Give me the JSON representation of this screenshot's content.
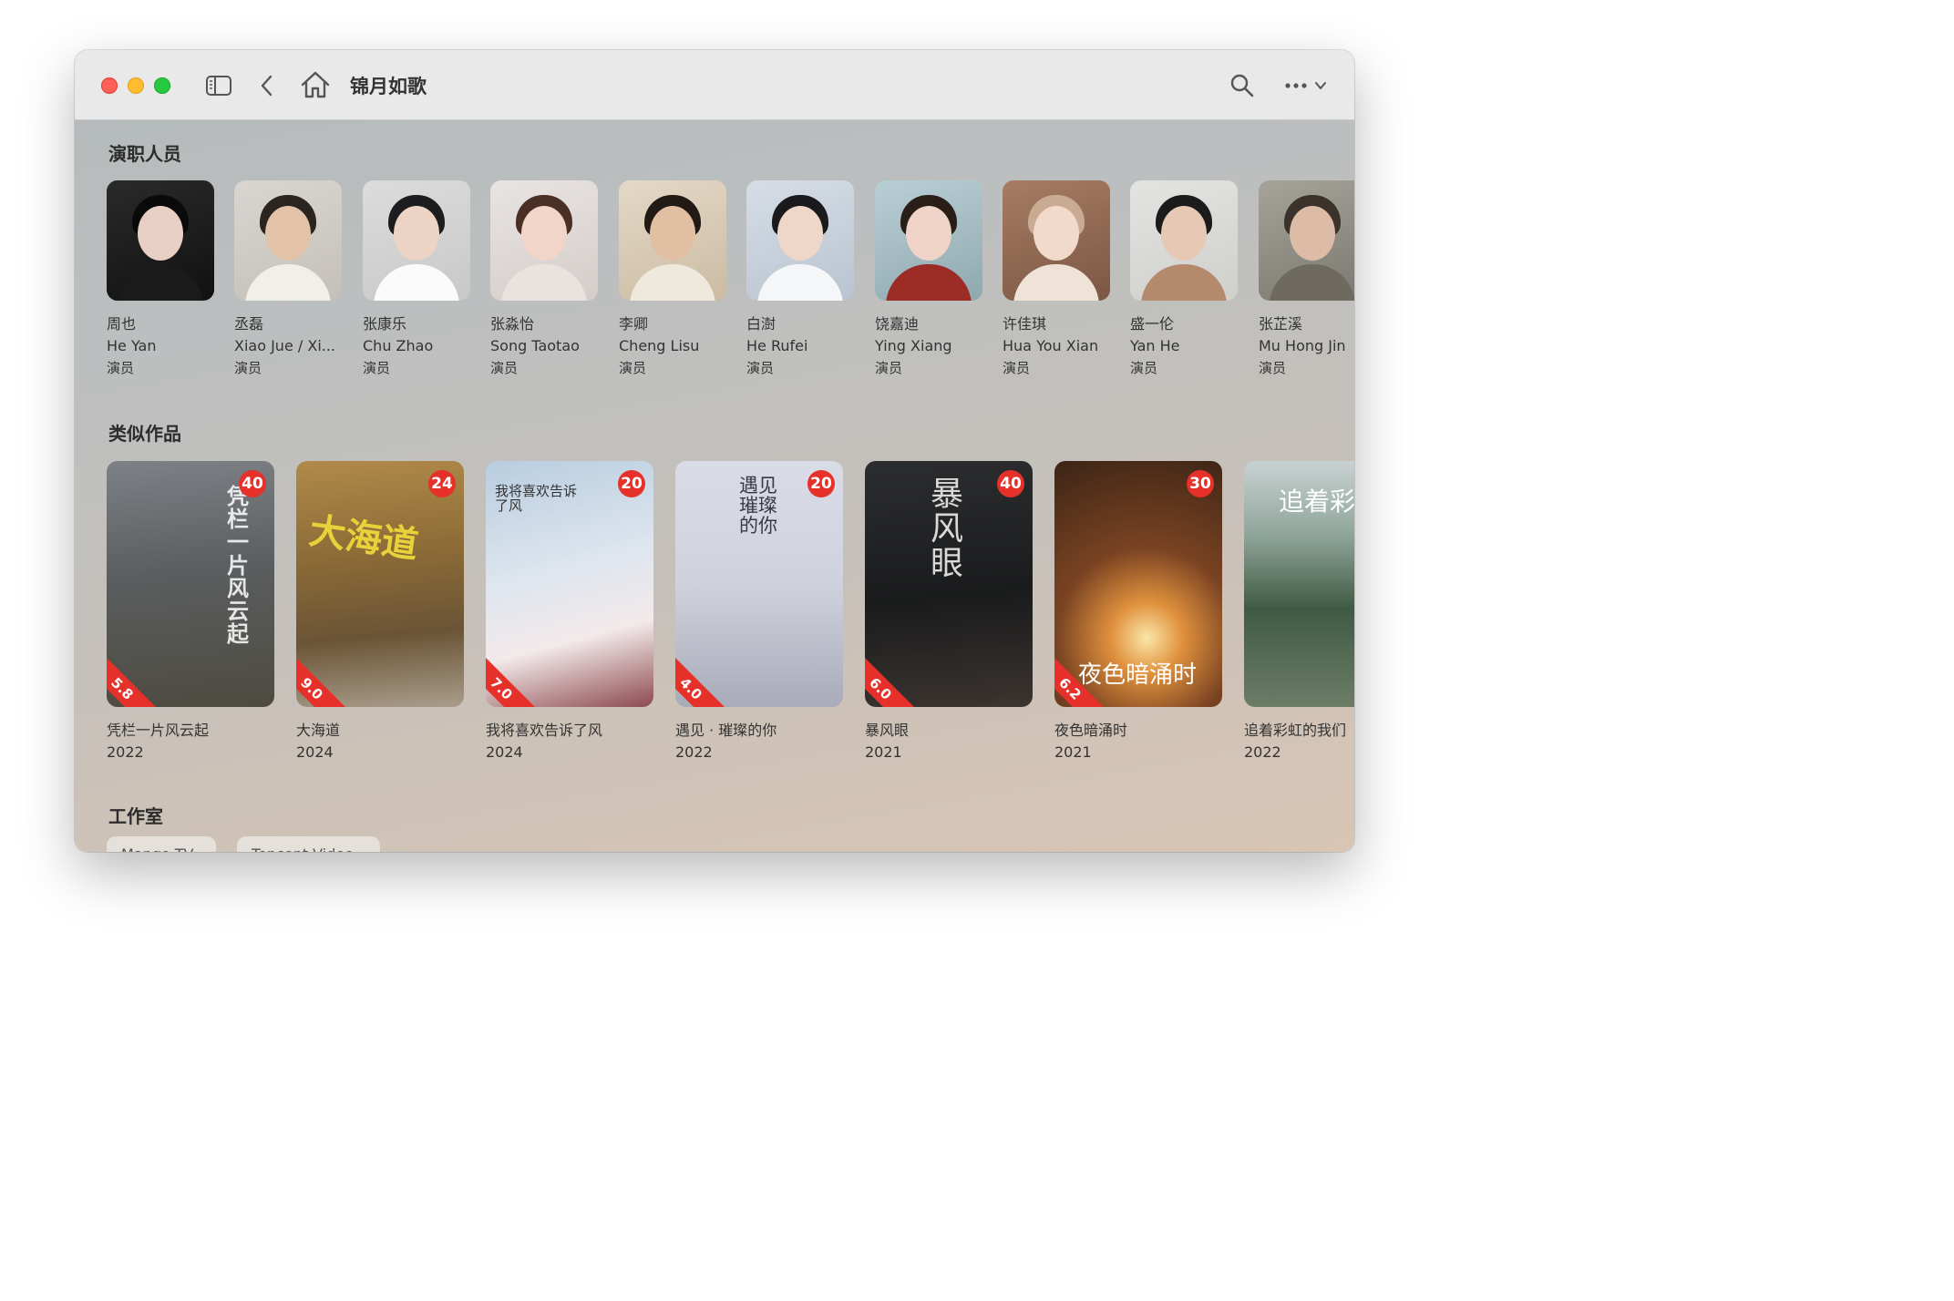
{
  "window": {
    "title": "锦月如歌"
  },
  "toolbar": {
    "icons": [
      "sidebar-toggle-icon",
      "back-chevron-icon",
      "home-icon",
      "search-icon",
      "more-ellipsis-icon",
      "chevron-down-icon"
    ]
  },
  "cast_section": {
    "title": "演职人员",
    "people": [
      {
        "name": "周也",
        "latin": "He Yan",
        "role": "演员"
      },
      {
        "name": "丞磊",
        "latin": "Xiao Jue / Xi...",
        "role": "演员"
      },
      {
        "name": "张康乐",
        "latin": "Chu Zhao",
        "role": "演员"
      },
      {
        "name": "张淼怡",
        "latin": "Song Taotao",
        "role": "演员"
      },
      {
        "name": "李卿",
        "latin": "Cheng Lisu",
        "role": "演员"
      },
      {
        "name": "白澍",
        "latin": "He Rufei",
        "role": "演员"
      },
      {
        "name": "饶嘉迪",
        "latin": "Ying Xiang",
        "role": "演员"
      },
      {
        "name": "许佳琪",
        "latin": "Hua You Xian",
        "role": "演员"
      },
      {
        "name": "盛一伦",
        "latin": "Yan He",
        "role": "演员"
      },
      {
        "name": "张芷溪",
        "latin": "Mu Hong Jin",
        "role": "演员"
      }
    ]
  },
  "similar_section": {
    "title": "类似作品",
    "works": [
      {
        "title": "凭栏一片风云起",
        "year": "2022",
        "count": "40",
        "rating": "5.8",
        "poster_text": "凭栏一片风云起"
      },
      {
        "title": "大海道",
        "year": "2024",
        "count": "24",
        "rating": "9.0",
        "poster_text": "大海道"
      },
      {
        "title": "我将喜欢告诉了风",
        "year": "2024",
        "count": "20",
        "rating": "7.0",
        "poster_text": "我将喜欢告诉了风"
      },
      {
        "title": "遇见 · 璀璨的你",
        "year": "2022",
        "count": "20",
        "rating": "4.0",
        "poster_text": "遇见璀璨的你"
      },
      {
        "title": "暴风眼",
        "year": "2021",
        "count": "40",
        "rating": "6.0",
        "poster_text": "暴风眼"
      },
      {
        "title": "夜色暗涌时",
        "year": "2021",
        "count": "30",
        "rating": "6.2",
        "poster_text": "夜色暗涌时"
      },
      {
        "title": "追着彩虹的我们",
        "year": "2022",
        "count": "",
        "rating": "",
        "poster_text": "追着彩虹"
      }
    ]
  },
  "studio_section": {
    "title": "工作室",
    "studios": [
      "Mango TV",
      "Tencent Video"
    ]
  },
  "colors": {
    "badge": "#e5312a"
  }
}
